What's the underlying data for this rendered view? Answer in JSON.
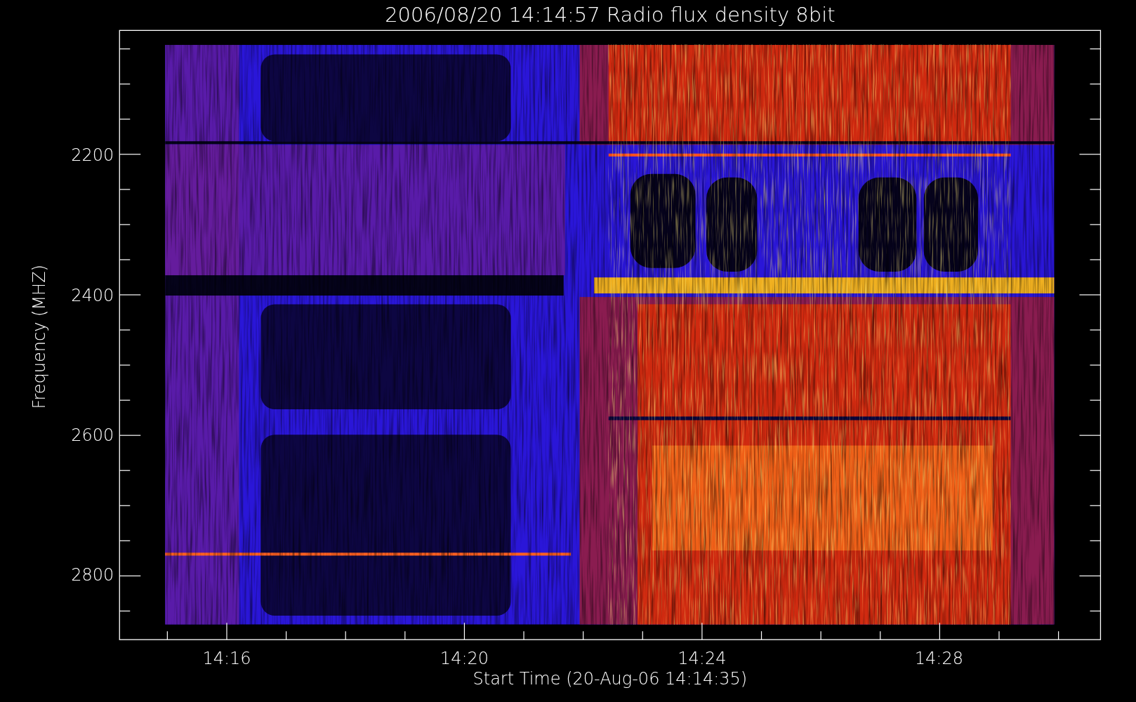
{
  "plot": {
    "title": "2006/08/20 14:14:57 Radio flux density 8bit",
    "y_axis": {
      "label": "Frequency (MHZ)",
      "ticks": [
        "2200",
        "2400",
        "2600",
        "2800"
      ]
    },
    "x_axis": {
      "label": "Start Time (20-Aug-06 14:14:35)",
      "ticks": [
        "14:16",
        "14:20",
        "14:24",
        "14:28"
      ]
    }
  }
}
